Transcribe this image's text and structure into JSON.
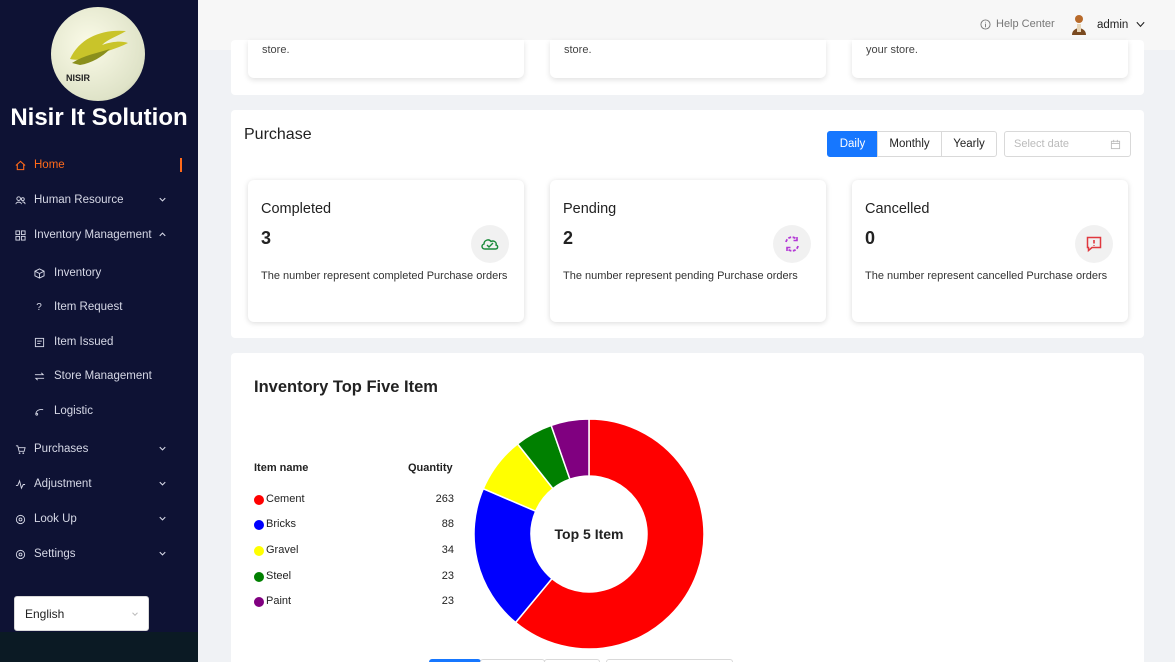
{
  "app": {
    "title": "Nisir It Solution",
    "logo_text": "NISIR"
  },
  "sidebar": {
    "items": [
      {
        "label": "Home",
        "icon": "home-icon"
      },
      {
        "label": "Human Resource",
        "icon": "users-icon"
      },
      {
        "label": "Inventory Management",
        "icon": "grid-icon"
      },
      {
        "label": "Inventory",
        "icon": "box-icon"
      },
      {
        "label": "Item Request",
        "icon": "question-icon"
      },
      {
        "label": "Item Issued",
        "icon": "document-icon"
      },
      {
        "label": "Store Management",
        "icon": "swap-icon"
      },
      {
        "label": "Logistic",
        "icon": "truck-icon"
      },
      {
        "label": "Purchases",
        "icon": "cart-icon"
      },
      {
        "label": "Adjustment",
        "icon": "pulse-icon"
      },
      {
        "label": "Look Up",
        "icon": "gear-icon"
      },
      {
        "label": "Settings",
        "icon": "gear-icon"
      }
    ],
    "language": "English"
  },
  "header": {
    "help": "Help Center",
    "user": "admin"
  },
  "top_cards": [
    "store.",
    "store.",
    "your store."
  ],
  "purchase": {
    "title": "Purchase",
    "tabs": [
      "Daily",
      "Monthly",
      "Yearly"
    ],
    "active_tab": "Daily",
    "date_placeholder": "Select date",
    "stats": [
      {
        "label": "Completed",
        "count": "3",
        "desc": "The number represent completed Purchase orders",
        "icon": "cloud-check-icon",
        "color": "#1a8a3a"
      },
      {
        "label": "Pending",
        "count": "2",
        "desc": "The number represent pending Purchase orders",
        "icon": "sync-icon",
        "color": "#b43ad6"
      },
      {
        "label": "Cancelled",
        "count": "0",
        "desc": "The number represent cancelled Purchase orders",
        "icon": "alert-message-icon",
        "color": "#e0383e"
      }
    ]
  },
  "inventory": {
    "title": "Inventory Top Five Item",
    "col_name": "Item name",
    "col_qty": "Quantity",
    "center_label": "Top 5 Item",
    "rows": [
      {
        "name": "Cement",
        "qty": "263",
        "color": "#ff0000"
      },
      {
        "name": "Bricks",
        "qty": "88",
        "color": "#0000ff"
      },
      {
        "name": "Gravel",
        "qty": "34",
        "color": "#ffff00"
      },
      {
        "name": "Steel",
        "qty": "23",
        "color": "#008000"
      },
      {
        "name": "Paint",
        "qty": "23",
        "color": "#800080"
      }
    ]
  },
  "chart_data": {
    "type": "pie",
    "categories": [
      "Cement",
      "Bricks",
      "Gravel",
      "Steel",
      "Paint"
    ],
    "values": [
      263,
      88,
      34,
      23,
      23
    ],
    "colors": [
      "#ff0000",
      "#0000ff",
      "#ffff00",
      "#008000",
      "#800080"
    ],
    "title": "Top 5 Item",
    "donut": true
  }
}
